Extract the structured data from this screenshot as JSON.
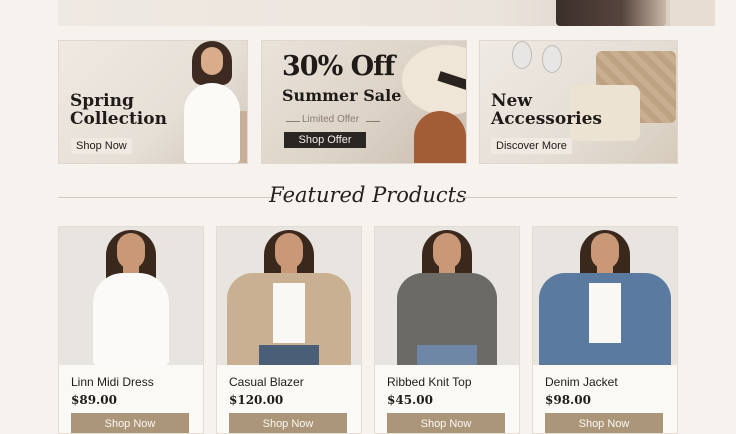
{
  "banners": [
    {
      "title": "Spring Collection",
      "button": "Shop Now"
    },
    {
      "headline": "30% Off",
      "subheadline": "Summer Sale",
      "tagline": "Limited Offer",
      "button": "Shop Offer"
    },
    {
      "title": "New Accessories",
      "button": "Discover More"
    }
  ],
  "featured": {
    "title": "Featured Products"
  },
  "products": [
    {
      "name": "Linn Midi Dress",
      "price": "$89.00",
      "button": "Shop Now"
    },
    {
      "name": "Casual Blazer",
      "price": "$120.00",
      "button": "Shop Now"
    },
    {
      "name": "Ribbed Knit Top",
      "price": "$45.00",
      "button": "Shop Now"
    },
    {
      "name": "Denim Jacket",
      "price": "$98.00",
      "button": "Shop Now"
    }
  ],
  "colors": {
    "accent": "#ab9679",
    "background": "#f6f2ed",
    "dark_button": "#2a2623"
  }
}
